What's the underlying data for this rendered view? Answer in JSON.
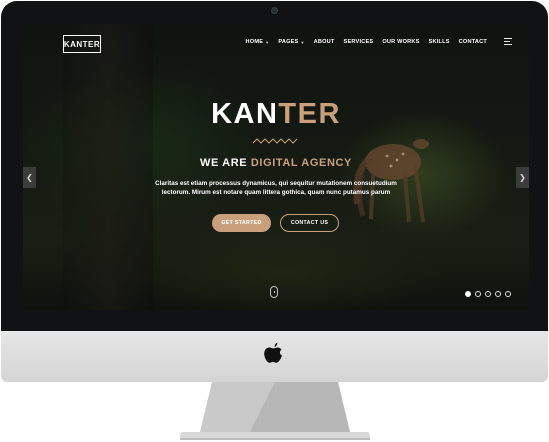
{
  "brand": {
    "logo": "KANTER"
  },
  "nav": {
    "items": [
      {
        "label": "HOME",
        "dropdown": true
      },
      {
        "label": "PAGES",
        "dropdown": true
      },
      {
        "label": "ABOUT",
        "dropdown": false
      },
      {
        "label": "SERVICES",
        "dropdown": false
      },
      {
        "label": "OUR WORKS",
        "dropdown": false
      },
      {
        "label": "SKILLS",
        "dropdown": false
      },
      {
        "label": "CONTACT",
        "dropdown": false
      }
    ],
    "menu_icon": "menu-icon"
  },
  "hero": {
    "title_main": "KAN",
    "title_accent": "TER",
    "tagline_main": "WE ARE",
    "tagline_accent": "DIGITAL AGENCY",
    "description_line1": "Claritas est etiam processus dynamicus, qui sequitur mutationem consuetudium",
    "description_line2": "lectorum. Mirum est notare quam littera gothica, quam nunc putamus parum",
    "primary_button": "GET STARTED",
    "secondary_button": "CONTACT US"
  },
  "slider": {
    "prev_icon": "chevron-left-icon",
    "next_icon": "chevron-right-icon",
    "dots_total": 5,
    "active_dot": 1
  },
  "colors": {
    "accent": "#c9a07a",
    "monitor_frame": "#111214",
    "chin": "#dcdcdc",
    "text": "#ffffff"
  }
}
